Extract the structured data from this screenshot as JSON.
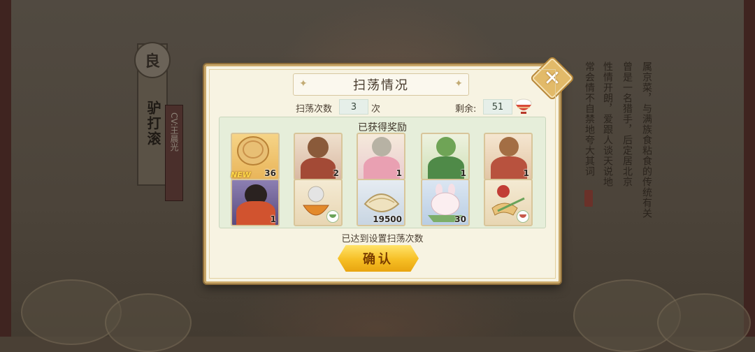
{
  "background": {
    "character_name": "驴打滚",
    "medal_char": "良",
    "cv_label": "CV:王晨光",
    "bio_lines": [
      "属京菜，与满族食粘食的传统有关",
      "曾是一名猎手，后定居北京",
      "性情开朗，爱跟人谈天说地",
      "常会情不自禁地夸大其词"
    ]
  },
  "dialog": {
    "title": "扫荡情况",
    "close_icon": "close-x-icon",
    "sweep_count_label": "扫荡次数",
    "sweep_count_value": "3",
    "sweep_count_unit": "次",
    "remaining_label": "剩余:",
    "remaining_value": "51",
    "remaining_icon": "rice-bowl-icon",
    "rewards_title": "已获得奖励",
    "rewards": [
      {
        "id": "coin",
        "name_icon": "coin-cookie-icon",
        "count": "36"
      },
      {
        "id": "char-brown",
        "name_icon": "character-card-icon",
        "count": "2"
      },
      {
        "id": "char-flower",
        "name_icon": "character-card-icon",
        "count": "1"
      },
      {
        "id": "char-green",
        "name_icon": "character-card-icon",
        "count": "1"
      },
      {
        "id": "char-ginger",
        "name_icon": "character-card-icon",
        "count": "1"
      },
      {
        "id": "char-warrior",
        "name_icon": "character-card-icon",
        "count": "1",
        "new_tag": "NEW"
      },
      {
        "id": "food-bun",
        "name_icon": "dish-icon",
        "count": ""
      },
      {
        "id": "dumpling",
        "name_icon": "dumpling-icon",
        "count": "19500"
      },
      {
        "id": "rabbit-bun",
        "name_icon": "rabbit-bun-icon",
        "count": "30"
      },
      {
        "id": "food-spoon",
        "name_icon": "dish-icon",
        "count": ""
      }
    ],
    "notice": "已达到设置扫荡次数",
    "confirm_label": "确认"
  },
  "colors": {
    "dialog_bg": "#f7f3e2",
    "gold_border": "#c9a768",
    "panel_bg": "#e6eeda",
    "button_gold": "#f6be24",
    "button_text": "#7a3d00"
  }
}
